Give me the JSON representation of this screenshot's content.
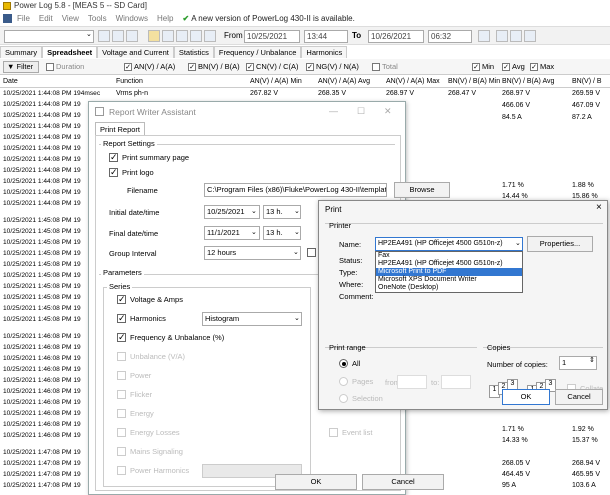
{
  "app": {
    "title": "Power Log 5.8 - [MEAS 5 -- SD Card]",
    "menu": [
      "File",
      "Edit",
      "View",
      "Tools",
      "Windows",
      "Help"
    ],
    "update_notice": "A new version of PowerLog 430-II is available."
  },
  "toolbar": {
    "from_label": "From",
    "from_date": "10/25/2021",
    "from_time": "13:44",
    "to_label": "To",
    "to_date": "10/26/2021",
    "to_time": "06:32"
  },
  "tabs": [
    "Summary",
    "Spreadsheet",
    "Voltage and Current",
    "Statistics",
    "Frequency / Unbalance",
    "Harmonics"
  ],
  "filter": {
    "filter_label": "Filter",
    "duration_label": "Duration",
    "checks": [
      "AN(V) / A(A)",
      "BN(V) / B(A)",
      "CN(V) / C(A)",
      "NG(V) / N(A)",
      "Total"
    ],
    "agg_checks": [
      "Min",
      "Avg",
      "Max"
    ]
  },
  "grid": {
    "headers": [
      "Date",
      "Function",
      "AN(V) / A(A) Min",
      "AN(V) / A(A) Avg",
      "AN(V) / A(A) Max",
      "BN(V) / B(A) Min",
      "BN(V) / B(A) Avg",
      "BN(V) / B"
    ],
    "first_row": {
      "date": "10/25/2021 1:44:08 PM 194msec",
      "function": "Vrms ph-n",
      "v1": "267.82 V",
      "v2": "268.35 V",
      "v3": "268.97 V",
      "v4": "268.47 V",
      "v5": "268.97 V",
      "v6": "269.59 V"
    },
    "dates": [
      "10/25/2021 1:44:08 PM 19",
      "10/25/2021 1:44:08 PM 19",
      "10/25/2021 1:44:08 PM 19",
      "10/25/2021 1:44:08 PM 19",
      "10/25/2021 1:44:08 PM 19",
      "10/25/2021 1:44:08 PM 19",
      "10/25/2021 1:44:08 PM 19",
      "10/25/2021 1:44:08 PM 19",
      "10/25/2021 1:44:08 PM 19",
      "10/25/2021 1:44:08 PM 19",
      "10/25/2021 1:45:08 PM 19",
      "10/25/2021 1:45:08 PM 19",
      "10/25/2021 1:45:08 PM 19",
      "10/25/2021 1:45:08 PM 19",
      "10/25/2021 1:45:08 PM 19",
      "10/25/2021 1:45:08 PM 19",
      "10/25/2021 1:45:08 PM 19",
      "10/25/2021 1:45:08 PM 19",
      "10/25/2021 1:45:08 PM 19",
      "10/25/2021 1:45:08 PM 19",
      "10/25/2021 1:46:08 PM 19",
      "10/25/2021 1:46:08 PM 19",
      "10/25/2021 1:46:08 PM 19",
      "10/25/2021 1:46:08 PM 19",
      "10/25/2021 1:46:08 PM 19",
      "10/25/2021 1:46:08 PM 19",
      "10/25/2021 1:46:08 PM 19",
      "10/25/2021 1:46:08 PM 19",
      "10/25/2021 1:46:08 PM 19",
      "10/25/2021 1:46:08 PM 19",
      "10/25/2021 1:47:08 PM 19",
      "10/25/2021 1:47:08 PM 19",
      "10/25/2021 1:47:08 PM 19",
      "10/25/2021 1:47:08 PM 19"
    ],
    "right_values": {
      "r2c1": "466.06 V",
      "r2c2": "467.09 V",
      "r3c1": "84.5 A",
      "r3c2": "87.2 A",
      "r4c1": "1.71 %",
      "r4c2": "1.88 %",
      "r5c1": "14.44 %",
      "r5c2": "15.86 %",
      "r6c1": "1.71 %",
      "r6c2": "1.92 %",
      "r7c1": "14.33 %",
      "r7c2": "15.37 %",
      "r8c1": "268.05 V",
      "r8c2": "268.94 V",
      "r9c1": "464.45 V",
      "r9c2": "465.95 V",
      "r10c1": "95 A",
      "r10c2": "103.6 A"
    }
  },
  "report_writer": {
    "title": "Report Writer Assistant",
    "tab": "Print Report",
    "settings_label": "Report Settings",
    "print_summary": "Print summary page",
    "print_logo": "Print logo",
    "filename_label": "Filename",
    "filename_value": "C:\\Program Files (x86)\\Fluke\\PowerLog 430-II\\templates",
    "browse": "Browse",
    "initial_label": "Initial date/time",
    "initial_date": "10/25/2021",
    "initial_time": "13 h.",
    "final_label": "Final date/time",
    "final_date": "11/1/2021",
    "final_time": "13 h.",
    "group_label": "Group Interval",
    "group_value": "12 hours",
    "fo_label": "Fo",
    "params_label": "Parameters",
    "series_label": "Series",
    "series": [
      "Voltage & Amps",
      "Harmonics",
      "Frequency & Unbalance (%)",
      "Unbalance (V/A)",
      "Power",
      "Flicker",
      "Energy",
      "Energy Losses",
      "Mains Signaling",
      "Power Harmonics"
    ],
    "harmonics_mode": "Histogram",
    "event_list": "Event list",
    "ok": "OK",
    "cancel": "Cancel"
  },
  "print_dialog": {
    "title": "Print",
    "printer_label": "Printer",
    "name_label": "Name:",
    "name_value": "HP2EA491 (HP Officejet 4500 G510n-z)",
    "properties": "Properties...",
    "status_label": "Status:",
    "type_label": "Type:",
    "where_label": "Where:",
    "comment_label": "Comment:",
    "options": [
      "Fax",
      "HP2EA491 (HP Officejet 4500 G510n-z)",
      "Microsoft Print to PDF",
      "Microsoft XPS Document Writer",
      "OneNote (Desktop)"
    ],
    "print_range": "Print range",
    "range_all": "All",
    "range_pages": "Pages",
    "from_label": "from",
    "to_label": "to:",
    "range_selection": "Selection",
    "copies": "Copies",
    "num_copies_label": "Number of copies:",
    "num_copies": "1",
    "collate": "Collate",
    "ok": "OK",
    "cancel": "Cancel",
    "close": "×",
    "stack_digits": [
      "1",
      "2",
      "3",
      "1",
      "2",
      "3"
    ]
  }
}
